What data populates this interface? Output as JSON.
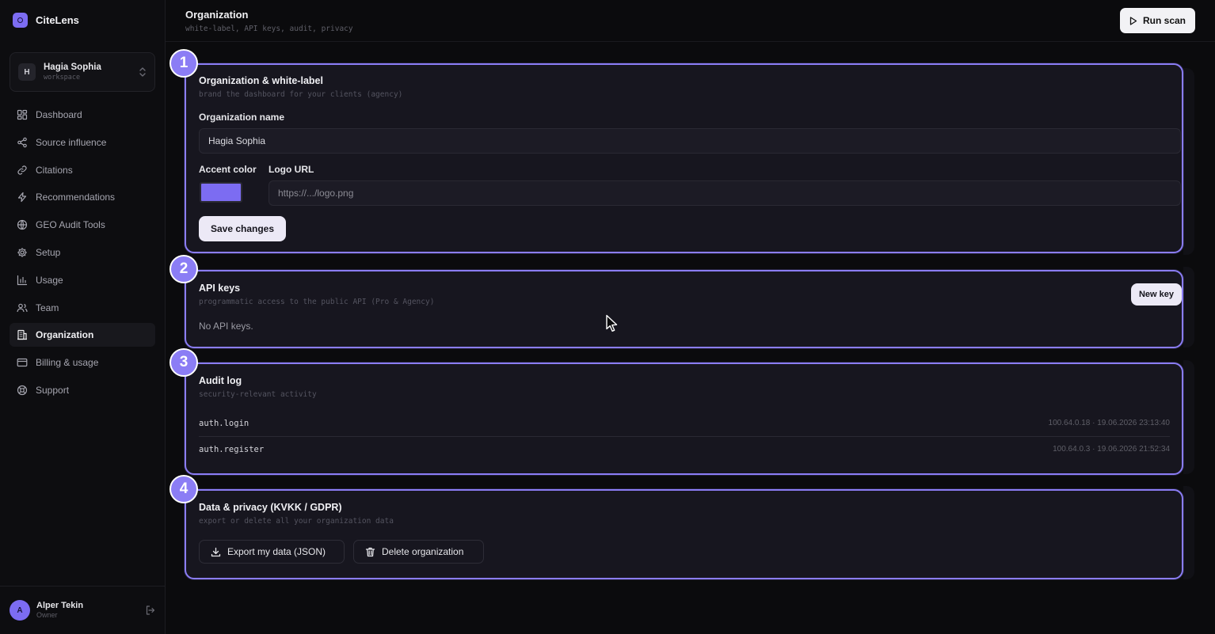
{
  "app": {
    "name": "CiteLens"
  },
  "workspace": {
    "initial": "H",
    "name": "Hagia Sophia",
    "label": "workspace"
  },
  "sidebar": {
    "items": [
      {
        "label": "Dashboard",
        "icon": "grid-icon"
      },
      {
        "label": "Source influence",
        "icon": "share-icon"
      },
      {
        "label": "Citations",
        "icon": "link-icon"
      },
      {
        "label": "Recommendations",
        "icon": "bolt-icon"
      },
      {
        "label": "GEO Audit Tools",
        "icon": "globe-icon"
      },
      {
        "label": "Setup",
        "icon": "gear-icon"
      },
      {
        "label": "Usage",
        "icon": "bar-chart-icon"
      },
      {
        "label": "Team",
        "icon": "users-icon"
      },
      {
        "label": "Organization",
        "icon": "building-icon",
        "active": true
      },
      {
        "label": "Billing & usage",
        "icon": "credit-card-icon"
      },
      {
        "label": "Support",
        "icon": "lifebuoy-icon"
      }
    ]
  },
  "user": {
    "initial": "A",
    "name": "Alper Tekin",
    "role": "Owner"
  },
  "header": {
    "title": "Organization",
    "subtitle": "white-label, API keys, audit, privacy",
    "run_scan_label": "Run scan"
  },
  "badges": [
    "1",
    "2",
    "3",
    "4"
  ],
  "org_card": {
    "title": "Organization & white-label",
    "subtitle": "brand the dashboard for your clients (agency)",
    "name_label": "Organization name",
    "name_value": "Hagia Sophia",
    "accent_label": "Accent color",
    "accent_color": "#7c6cf2",
    "logo_label": "Logo URL",
    "logo_placeholder": "https://.../logo.png",
    "save_label": "Save changes"
  },
  "api_card": {
    "title": "API keys",
    "subtitle": "programmatic access to the public API (Pro & Agency)",
    "new_key_label": "New key",
    "empty_text": "No API keys."
  },
  "audit_card": {
    "title": "Audit log",
    "subtitle": "security-relevant activity",
    "rows": [
      {
        "action": "auth.login",
        "meta": "100.64.0.18 · 19.06.2026 23:13:40"
      },
      {
        "action": "auth.register",
        "meta": "100.64.0.3 · 19.06.2026 21:52:34"
      }
    ]
  },
  "privacy_card": {
    "title": "Data & privacy (KVKK / GDPR)",
    "subtitle": "export or delete all your organization data",
    "export_label": "Export my data (JSON)",
    "delete_label": "Delete organization"
  },
  "colors": {
    "accent": "#8b7df5",
    "brand": "#7c6cf2",
    "background": "#0b0b0d",
    "card": "#17161f"
  }
}
